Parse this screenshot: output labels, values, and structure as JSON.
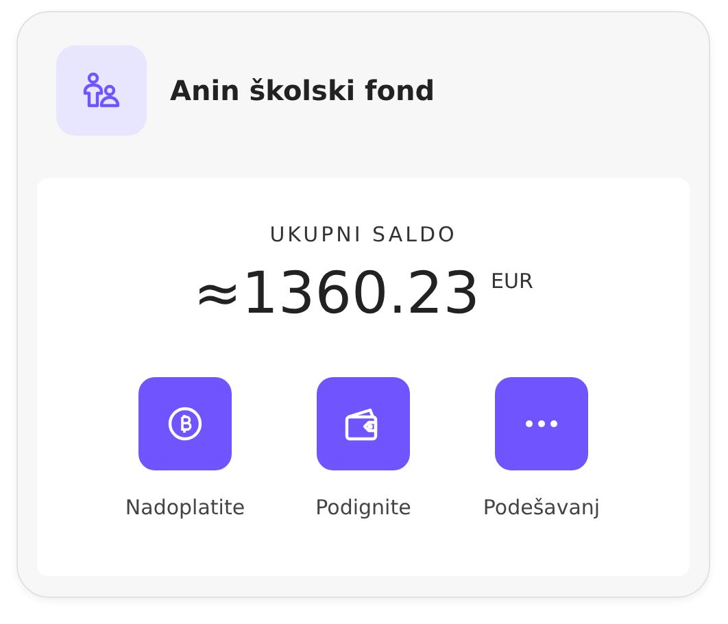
{
  "header": {
    "title": "Anin školski fond"
  },
  "balance": {
    "label": "UKUPNI SALDO",
    "amount": "≈1360.23",
    "currency": "EUR"
  },
  "actions": [
    {
      "kind": "coin",
      "label": "Nadoplatite"
    },
    {
      "kind": "wallet",
      "label": "Podignite"
    },
    {
      "kind": "more",
      "label": "Podešavanj"
    }
  ]
}
